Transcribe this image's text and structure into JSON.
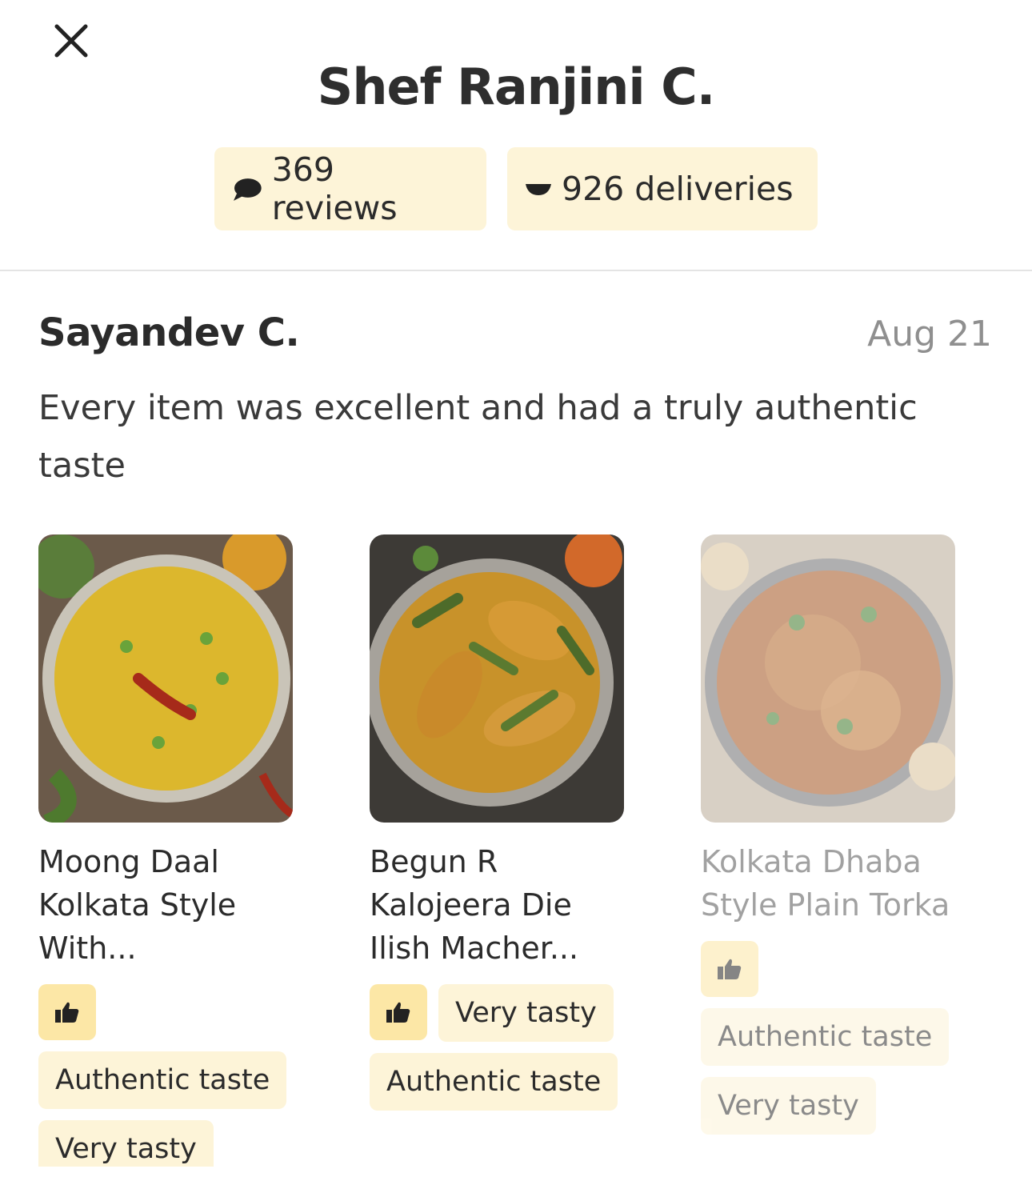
{
  "header": {
    "close_icon": "close-icon",
    "title": "Shef Ranjini C."
  },
  "stats": {
    "reviews_icon": "chat-bubble-icon",
    "reviews": "369 reviews",
    "deliveries_icon": "bowl-icon",
    "deliveries": "926 deliveries"
  },
  "review": {
    "author": "Sayandev C.",
    "date": "Aug 21",
    "text": "Every item was excellent and had a truly authentic taste"
  },
  "dishes": [
    {
      "name": "Moong Daal\nKolkata Style\nWith...",
      "thumb_icon": "thumbs-up-icon",
      "tags": [
        "Authentic taste",
        "Very tasty"
      ]
    },
    {
      "name": "Begun R\nKalojeera Die\nIlish Macher...",
      "thumb_icon": "thumbs-up-icon",
      "tags": [
        "Very tasty",
        "Authentic taste"
      ]
    },
    {
      "name": "Kolkata Dhaba\nStyle Plain Torka",
      "thumb_icon": "thumbs-up-icon",
      "tags": [
        "Authentic taste",
        "Very tasty"
      ]
    }
  ],
  "colors": {
    "pill_bg": "#fdf4d8",
    "thumb_bg": "#fce7a6",
    "date_text": "#8f8f8f"
  }
}
